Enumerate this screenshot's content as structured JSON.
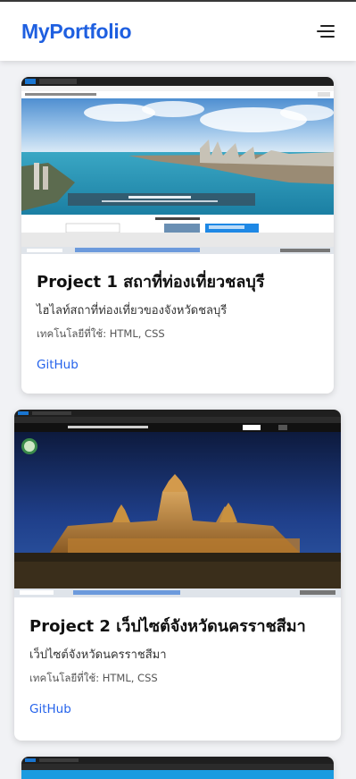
{
  "header": {
    "brand": "MyPortfolio",
    "menu_icon": "hamburger-menu-icon"
  },
  "projects": [
    {
      "title": "Project 1 สถาที่ท่องเที่ยวชลบุรี",
      "description": "ไฮไลท์สถาที่ท่องเที่ยวของจังหวัดชลบุรี",
      "tech": "เทคโนโลยีที่ใช้: HTML, CSS",
      "link": "GitHub"
    },
    {
      "title": "Project 2 เว็ปไซต์จังหวัดนครราชสีมา",
      "description": "เว็ปไซต์จังหวัดนครราชสีมา",
      "tech": "เทคโนโลยีที่ใช้: HTML, CSS",
      "link": "GitHub"
    }
  ],
  "colors": {
    "brand": "#1e5fe0",
    "link": "#2563eb",
    "background": "#f1f2f5"
  }
}
